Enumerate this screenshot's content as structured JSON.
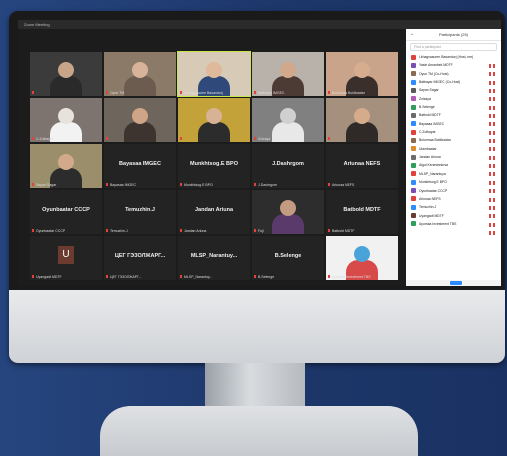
{
  "window": {
    "title": "Zoom Meeting"
  },
  "tiles": [
    {
      "name": "",
      "label": "",
      "video": "#3b3b3b",
      "skin": "#c8a589",
      "shirt": "#2a2a2a"
    },
    {
      "name": "Oyun TM",
      "label": "",
      "video": "#8c7a68",
      "skin": "#d7b39a",
      "shirt": "#6b5c4f"
    },
    {
      "name": "Lkhagvasuren Basandorj",
      "label": "",
      "video": "#d7cbb8",
      "skin": "#e0b89a",
      "shirt": "#2f4a7a",
      "active": true
    },
    {
      "name": "Batbayar IMGEC",
      "label": "",
      "video": "#b9b2ab",
      "skin": "#d1a88c",
      "shirt": "#4c3b34"
    },
    {
      "name": "Bolormaa Boldbaatar",
      "label": "",
      "video": "#c9a38a",
      "skin": "#d6ad8f",
      "shirt": "#3a2f2b"
    },
    {
      "name": "C.Zolbayar",
      "label": "",
      "video": "#7d7470",
      "skin": "#e8e2dc",
      "shirt": "#f2f2f2"
    },
    {
      "name": "",
      "label": "",
      "video": "#6e655d",
      "skin": "#cfa487",
      "shirt": "#3d3430"
    },
    {
      "name": "",
      "label": "",
      "video": "#c4a23a",
      "skin": "#d8b295",
      "shirt": "#2c2c2c"
    },
    {
      "name": "Zolzaya",
      "label": "",
      "video": "#808080",
      "skin": "#d0d0d0",
      "shirt": "#e8e8e8"
    },
    {
      "name": "",
      "label": "",
      "video": "#a58f7d",
      "skin": "#d5ab8c",
      "shirt": "#2f2a28"
    },
    {
      "name": "Sayan Sagar",
      "label": "",
      "video": "#9a8f6a",
      "skin": "#d2aa8b",
      "shirt": "#2c2c2c"
    },
    {
      "name": "Bayasaa IMGEC",
      "label": "Bayasaa IMGEC"
    },
    {
      "name": "Munkhtsog.E BPO",
      "label": "Munkhtsog.E BPO"
    },
    {
      "name": "J.Dashrgom",
      "label": "J.Dashrgom"
    },
    {
      "name": "Ariunaa NEFS",
      "label": "Ariunaa NEFS"
    },
    {
      "name": "Oyunbaatar CCCP",
      "label": "Oyunbaatar CCCP"
    },
    {
      "name": "Temuzhin.J",
      "label": "Temuzhin.J"
    },
    {
      "name": "Jandan Ariuna",
      "label": "Jandan Ariuna"
    },
    {
      "name": "Fuji",
      "label": "",
      "video": "#2d2d2d",
      "skin": "#c39a82",
      "shirt": "#5a3a6a"
    },
    {
      "name": "Batbold MDTF",
      "label": "Batbold MDTF"
    },
    {
      "name": "Uyangadt MDTF",
      "label": "",
      "avatar": "U"
    },
    {
      "name": "ЦЕГ ГЭЗОЛЖАРГ...",
      "label": "ЦЕГ ГЭЗОЛЖАРГ..."
    },
    {
      "name": "MLSP_Narantuy...",
      "label": "MLSP_Narantuy..."
    },
    {
      "name": "B.Selenge",
      "label": "B.Selenge"
    },
    {
      "name": "Ayumaa Investment TBS",
      "label": "",
      "video": "#f1f1f1",
      "skin": "#4aa3d8",
      "shirt": "#d84a4a"
    }
  ],
  "participants": {
    "title": "Participants (25)",
    "search_placeholder": "Find a participant",
    "rows": [
      {
        "name": "Lkhagvasuren Basandorj (Host, me)",
        "color": "#e0433b"
      },
      {
        "name": "Yasin Amanbek MDTF",
        "color": "#7a4fb5"
      },
      {
        "name": "Oyun TM (Co-Host)",
        "color": "#8c6a4f"
      },
      {
        "name": "Batbayar IMGEC (Co-Host)",
        "color": "#2d8cff"
      },
      {
        "name": "Sayan Sagar",
        "color": "#5a5a5a"
      },
      {
        "name": "Zolzaya",
        "color": "#b05ab6"
      },
      {
        "name": "B.Selenge",
        "color": "#2e9e5a"
      },
      {
        "name": "Batbold MDTF",
        "color": "#6b6b6b"
      },
      {
        "name": "Bayasaa IMGEC",
        "color": "#2d8cff"
      },
      {
        "name": "C.Zolbayar",
        "color": "#e0433b"
      },
      {
        "name": "Bolormaa Boldbaatar",
        "color": "#8c6a4f"
      },
      {
        "name": "Ulambaatar",
        "color": "#e08a2b"
      },
      {
        "name": "Jandan Ariuna",
        "color": "#6b6b6b"
      },
      {
        "name": "Aigul Kenesbekova",
        "color": "#2e9e5a"
      },
      {
        "name": "MLSP_Narantuya",
        "color": "#e0433b"
      },
      {
        "name": "Munkhtsog.E BPO",
        "color": "#2d8cff"
      },
      {
        "name": "Oyunbaatar CCCP",
        "color": "#7a4fb5"
      },
      {
        "name": "Ariunaa NEFS",
        "color": "#e0433b"
      },
      {
        "name": "Temuzhin.J",
        "color": "#2d8cff"
      },
      {
        "name": "Uyangadt MDTF",
        "color": "#6a3b2e"
      },
      {
        "name": "Ayumaa Investment TBS",
        "color": "#2e9e5a"
      }
    ]
  }
}
